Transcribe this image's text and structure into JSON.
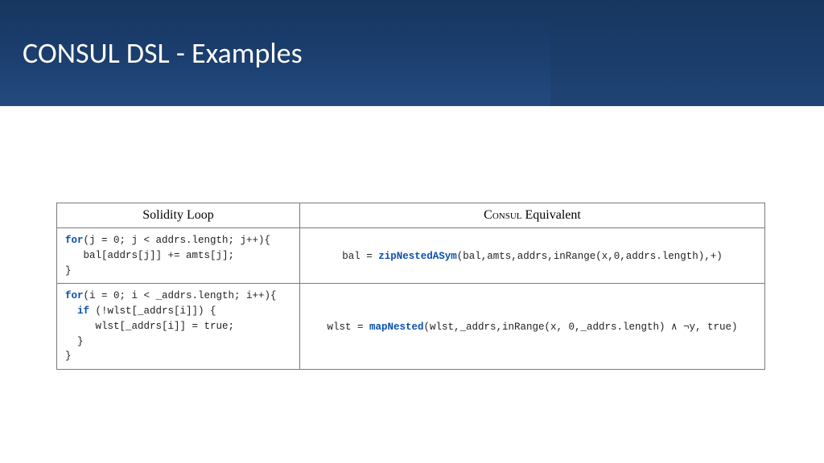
{
  "title": "CONSUL DSL - Examples",
  "table": {
    "headers": {
      "left": "Solidity Loop",
      "right_prefix": "Consul",
      "right_suffix": " Equivalent"
    },
    "rows": [
      {
        "sol": {
          "kw1": "for",
          "l1a": "(j = 0; j < addrs.length; j++){",
          "l2": "   bal[addrs[j]] += amts[j];",
          "l3": "}"
        },
        "con": {
          "pre": "bal = ",
          "fn": "zipNestedASym",
          "post": "(bal,amts,addrs,inRange(x,0,addrs.length),+)"
        }
      },
      {
        "sol": {
          "kw1": "for",
          "l1a": "(i = 0; i < _addrs.length; i++){",
          "kw2": "if",
          "l2a": " (!wlst[_addrs[i]]) {",
          "l3": "     wlst[_addrs[i]] = true;",
          "l4": "  }",
          "l5": "}"
        },
        "con": {
          "pre": "wlst = ",
          "fn": "mapNested",
          "post": "(wlst,_addrs,inRange(x, 0,_addrs.length) ∧ ¬y, true)"
        }
      }
    ]
  }
}
